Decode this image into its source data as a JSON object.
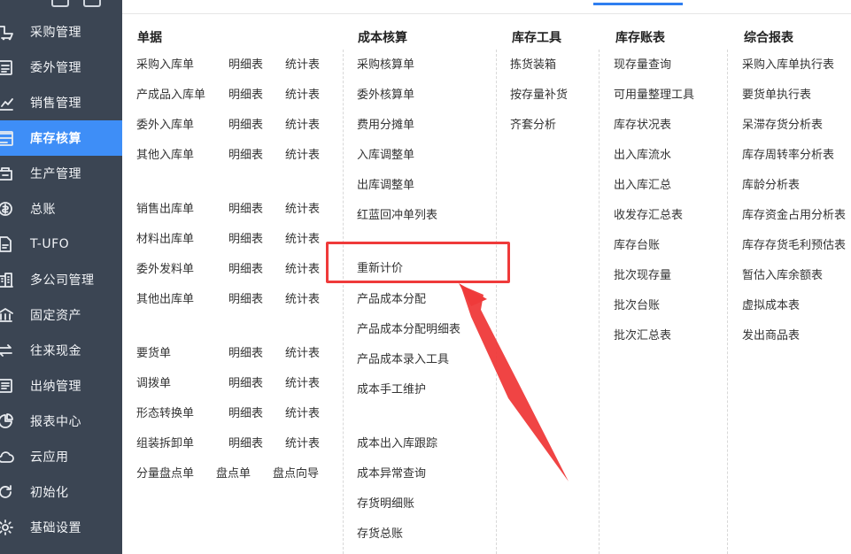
{
  "sidebar": {
    "items": [
      {
        "label": "采购管理",
        "icon": "purchase-icon"
      },
      {
        "label": "委外管理",
        "icon": "outsource-icon"
      },
      {
        "label": "销售管理",
        "icon": "sales-chart-icon"
      },
      {
        "label": "库存核算",
        "icon": "inventory-icon",
        "active": true
      },
      {
        "label": "生产管理",
        "icon": "production-icon"
      },
      {
        "label": "总账",
        "icon": "ledger-icon"
      },
      {
        "label": "T-UFO",
        "icon": "report-file-icon"
      },
      {
        "label": "多公司管理",
        "icon": "multi-company-icon"
      },
      {
        "label": "固定资产",
        "icon": "bank-icon"
      },
      {
        "label": "往来现金",
        "icon": "exchange-icon"
      },
      {
        "label": "出纳管理",
        "icon": "cashier-icon"
      },
      {
        "label": "报表中心",
        "icon": "pie-chart-icon"
      },
      {
        "label": "云应用",
        "icon": "cloud-icon"
      },
      {
        "label": "初始化",
        "icon": "refresh-icon"
      },
      {
        "label": "基础设置",
        "icon": "settings-icon"
      }
    ]
  },
  "colors": {
    "sidebar_bg": "#3b4553",
    "active": "#3e8ef7",
    "annotation": "#ef3a3a"
  },
  "menu": {
    "danju": {
      "title": "单据",
      "rows": [
        [
          "采购入库单",
          "明细表",
          "统计表"
        ],
        [
          "产成品入库单",
          "明细表",
          "统计表"
        ],
        [
          "委外入库单",
          "明细表",
          "统计表"
        ],
        [
          "其他入库单",
          "明细表",
          "统计表"
        ],
        [
          "销售出库单",
          "明细表",
          "统计表"
        ],
        [
          "材料出库单",
          "明细表",
          "统计表"
        ],
        [
          "委外发料单",
          "明细表",
          "统计表"
        ],
        [
          "其他出库单",
          "明细表",
          "统计表"
        ],
        [
          "要货单",
          "明细表",
          "统计表"
        ],
        [
          "调拨单",
          "明细表",
          "统计表"
        ],
        [
          "形态转换单",
          "明细表",
          "统计表"
        ],
        [
          "组装拆卸单",
          "明细表",
          "统计表"
        ],
        [
          "分量盘点单",
          "盘点单",
          "盘点向导"
        ]
      ]
    },
    "chengben": {
      "title": "成本核算",
      "items": [
        "采购核算单",
        "委外核算单",
        "费用分摊单",
        "入库调整单",
        "出库调整单",
        "红蓝回冲单列表",
        "重新计价",
        "产品成本分配",
        "产品成本分配明细表",
        "产品成本录入工具",
        "成本手工维护",
        "成本出入库跟踪",
        "成本异常查询",
        "存货明细账",
        "存货总账"
      ]
    },
    "gongju": {
      "title": "库存工具",
      "items": [
        "拣货装箱",
        "按存量补货",
        "齐套分析"
      ]
    },
    "zhangbiao": {
      "title": "库存账表",
      "items": [
        "现存量查询",
        "可用量整理工具",
        "库存状况表",
        "出入库流水",
        "出入库汇总",
        "收发存汇总表",
        "库存台账",
        "批次现存量",
        "批次台账",
        "批次汇总表"
      ]
    },
    "zonghe": {
      "title": "综合报表",
      "items": [
        "采购入库单执行表",
        "要货单执行表",
        "呆滞存货分析表",
        "库存周转率分析表",
        "库龄分析表",
        "库存资金占用分析表",
        "库存存货毛利预估表",
        "暂估入库余额表",
        "虚拟成本表",
        "发出商品表"
      ]
    }
  }
}
